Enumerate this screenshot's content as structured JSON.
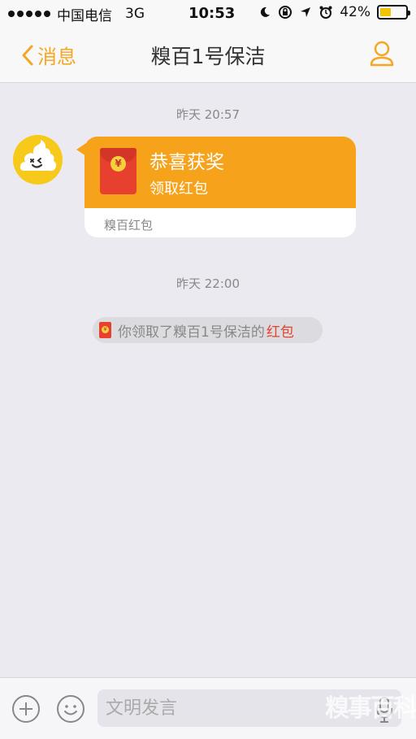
{
  "status_bar": {
    "carrier": "中国电信",
    "network": "3G",
    "time": "10:53",
    "battery_percent": "42%",
    "battery_level": 0.42
  },
  "nav": {
    "back_label": "消息",
    "title": "糗百1号保洁",
    "accent_color": "#f5a623"
  },
  "chat": {
    "messages": [
      {
        "timestamp": "昨天 20:57",
        "red_packet": {
          "title": "恭喜获奖",
          "subtitle": "领取红包",
          "footer": "糗百红包",
          "currency_symbol": "¥"
        }
      },
      {
        "timestamp": "昨天 22:00",
        "notice": {
          "text": "你领取了糗百1号保洁的",
          "link": "红包",
          "currency_symbol": "¥"
        }
      }
    ]
  },
  "toolbar": {
    "input_placeholder": "文明发言",
    "watermark": "糗事百科"
  },
  "colors": {
    "bubble_orange": "#f7a21b",
    "red_packet": "#e8402f",
    "background": "#ebeaf0"
  }
}
